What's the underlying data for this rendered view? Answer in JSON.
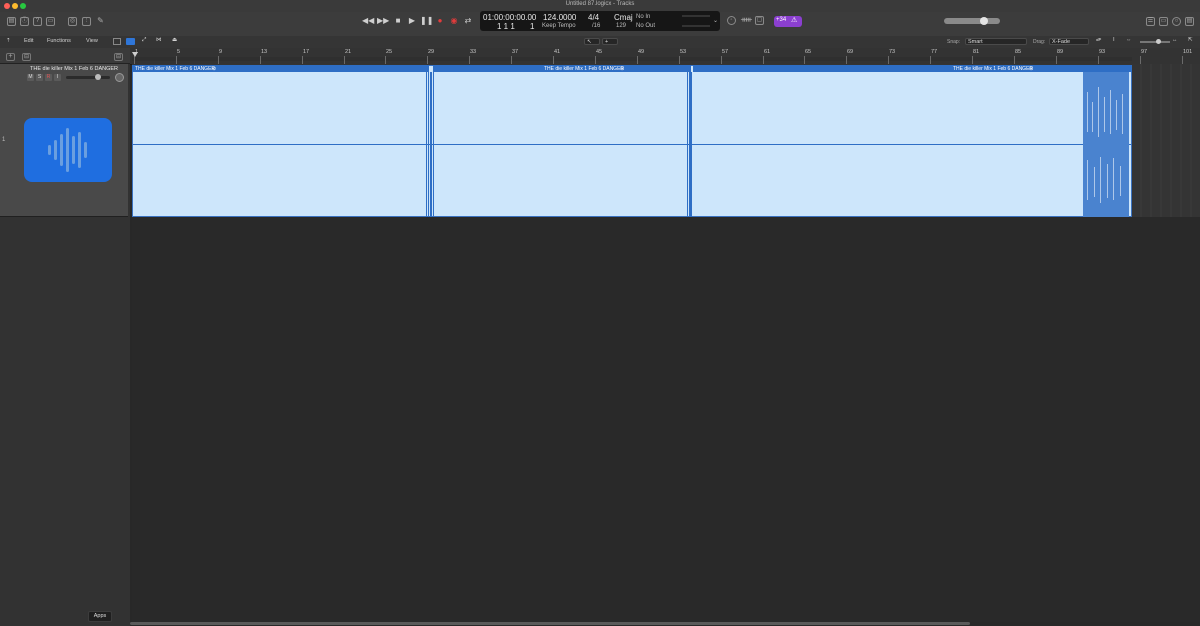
{
  "window": {
    "title": "Untitled 87.logicx - Tracks",
    "traffic_colors": [
      "#ff5f57",
      "#febc2e",
      "#28c840"
    ]
  },
  "transport": {
    "timecode": "01:00:00:00.00",
    "bar_position": "1  1  1",
    "beat_position": "1",
    "tempo": "124.0000",
    "tempo_mode": "Keep Tempo",
    "time_signature": "4/4",
    "division": "/16",
    "key": "Cmaj",
    "key_value": "129",
    "input": "No In",
    "output": "No Out",
    "badge_count": "+34"
  },
  "toolbar": {
    "edit": "Edit",
    "functions": "Functions",
    "view": "View",
    "snap_label": "Snap:",
    "snap_value": "Smart",
    "drag_label": "Drag:",
    "drag_value": "X-Fade"
  },
  "ruler": {
    "bars": [
      "1",
      "5",
      "9",
      "13",
      "17",
      "21",
      "25",
      "29",
      "33",
      "37",
      "41",
      "45",
      "49",
      "53",
      "57",
      "61",
      "65",
      "69",
      "73",
      "77",
      "81",
      "85",
      "89",
      "93",
      "97",
      "101"
    ]
  },
  "track": {
    "number": "1",
    "name": "THE die killer Mix 1 Feb 6 DANGER",
    "mute": "M",
    "solo": "S",
    "record": "R",
    "input_monitor": "I"
  },
  "region": {
    "segments": [
      {
        "title": "THE die killer Mix 1 Feb 6 DANGER"
      },
      {
        "title": "THE die killer Mix 1 Feb 6 DANGER"
      },
      {
        "title": "THE die killer Mix 1 Feb 6 DANGER"
      }
    ],
    "color": "#cde6fb",
    "header_color": "#2e6ec5"
  },
  "tooltip": {
    "apps": "Apps"
  }
}
